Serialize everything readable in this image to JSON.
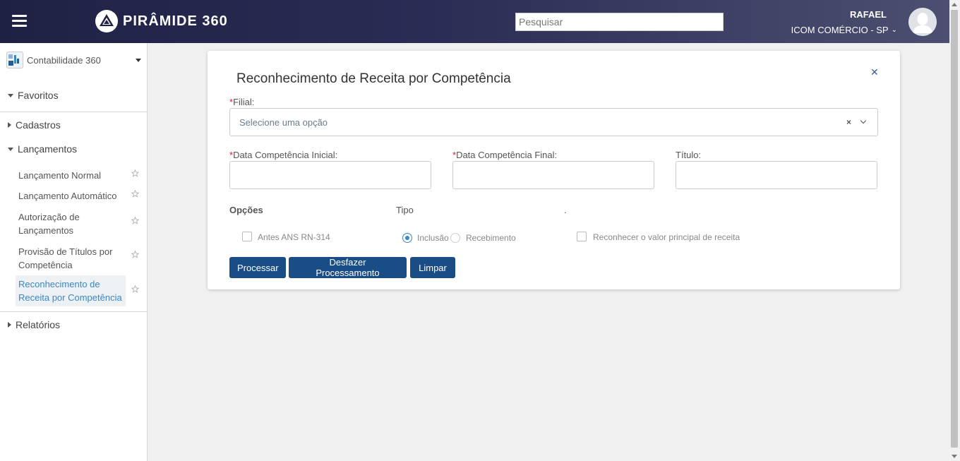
{
  "header": {
    "brand": "PIRÂMIDE 360",
    "search_placeholder": "Pesquisar",
    "user_name": "RAFAEL",
    "company": "ICOM COMÉRCIO - SP"
  },
  "sidebar": {
    "module": "Contabilidade 360",
    "sections": {
      "favoritos": "Favoritos",
      "cadastros": "Cadastros",
      "lancamentos": "Lançamentos",
      "relatorios": "Relatórios"
    },
    "items": [
      {
        "label": "Lançamento Normal"
      },
      {
        "label": "Lançamento Automático"
      },
      {
        "label": "Autorização de Lançamentos"
      },
      {
        "label": "Provisão de Títulos por Competência"
      },
      {
        "label": "Reconhecimento de Receita por Competência"
      }
    ]
  },
  "form": {
    "title": "Reconhecimento de Receita por Competência",
    "required_mark": "*",
    "filial_label": "Filial:",
    "filial_placeholder": "Selecione uma opção",
    "data_inicial_label": "Data Competência Inicial:",
    "data_final_label": "Data Competência Final:",
    "titulo_label": "Título:",
    "opcoes_label": "Opções",
    "tipo_label": "Tipo",
    "dot_label": ".",
    "antes_ans_label": "Antes ANS RN-314",
    "inclusao_label": "Inclusão",
    "recebimento_label": "Recebimento",
    "reconhecer_label": "Reconhecer o valor principal de receita",
    "buttons": {
      "processar": "Processar",
      "desfazer": "Desfazer Processamento",
      "limpar": "Limpar"
    }
  },
  "colors": {
    "header_start": "#1f2144",
    "header_end": "#4d4f70",
    "primary_button": "#1a4c85",
    "active_link": "#3a87c2",
    "required": "#dd2222"
  }
}
